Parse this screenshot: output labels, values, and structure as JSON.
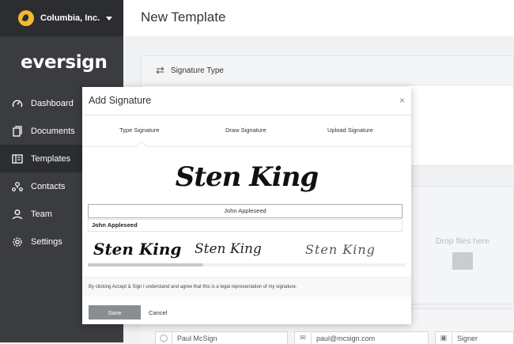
{
  "org": {
    "name": "Columbia, Inc."
  },
  "brand": {
    "name": "eversign"
  },
  "nav": [
    {
      "label": "Dashboard",
      "icon": "dashboard-icon"
    },
    {
      "label": "Documents",
      "icon": "documents-icon"
    },
    {
      "label": "Templates",
      "icon": "templates-icon",
      "active": true
    },
    {
      "label": "Contacts",
      "icon": "contacts-icon"
    },
    {
      "label": "Team",
      "icon": "team-icon"
    },
    {
      "label": "Settings",
      "icon": "settings-icon"
    }
  ],
  "page": {
    "title": "New Template"
  },
  "panel": {
    "section_label": "Signature Type"
  },
  "dropzone": {
    "text": "Drop files here"
  },
  "fields": {
    "name": "Paul McSign",
    "email": "paul@mcsign.com",
    "role": "Signer"
  },
  "modal": {
    "title": "Add Signature",
    "close": "×",
    "tabs": [
      "Type Signature",
      "Draw Signature",
      "Upload Signature"
    ],
    "signature_preview": "Sten King",
    "name_input_value": "John Appleseed",
    "suggestion": "John Appleseed",
    "options": [
      "Sten King",
      "Sten King",
      "Sten King"
    ],
    "legal_text": "By clicking Accept & Sign I understand and agree that this is a legal representation of my signature.",
    "save_label": "Save",
    "cancel_label": "Cancel"
  },
  "colors": {
    "sidebar": "#3a3c40",
    "sidebar_dark": "#2b2d30",
    "logo": "#f5b82e",
    "save_button": "#8a8d91"
  }
}
